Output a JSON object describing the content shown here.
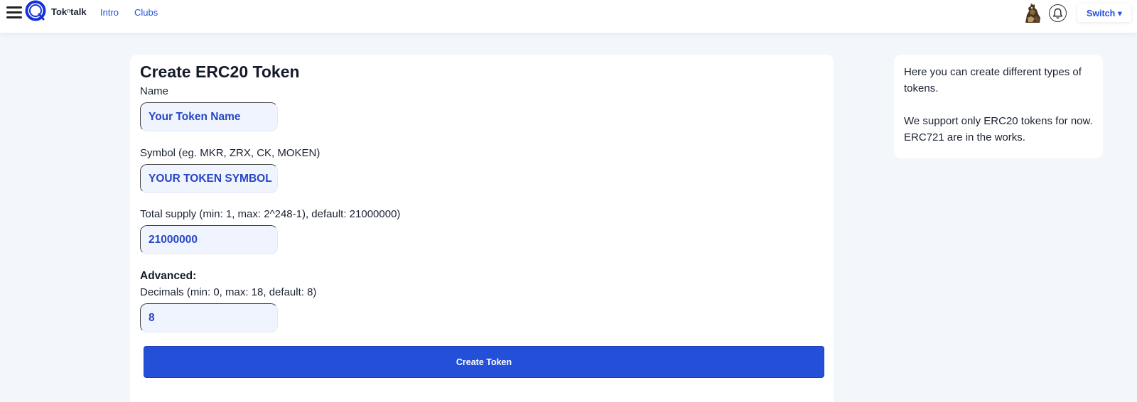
{
  "header": {
    "brand": {
      "prefix": "Tok",
      "middle": "n",
      "suffix": "talk"
    },
    "nav": [
      {
        "label": "Intro"
      },
      {
        "label": "Clubs"
      }
    ],
    "switch_label": "Switch ▾",
    "icons": {
      "menu": "hamburger-icon",
      "logo": "tokntalk-logo-icon",
      "avatar": "avatar-image",
      "notifications": "bell-icon"
    }
  },
  "form": {
    "title": "Create ERC20 Token",
    "name": {
      "label": "Name",
      "placeholder": "Your Token Name"
    },
    "symbol": {
      "label": "Symbol (eg. MKR, ZRX, CK, MOKEN)",
      "placeholder": "YOUR TOKEN SYMBOL"
    },
    "supply": {
      "label": "Total supply (min: 1, max: 2^248-1), default: 21000000)",
      "value": "21000000"
    },
    "advanced_label": "Advanced:",
    "decimals": {
      "label": "Decimals (min: 0, max: 18, default: 8)",
      "value": "8"
    },
    "submit_label": "Create Token"
  },
  "info": {
    "paragraphs": [
      "Here you can create different types of tokens.",
      "We support only ERC20 tokens for now. ERC721 are in the works."
    ]
  },
  "colors": {
    "accent": "#2450d9",
    "page_background": "#f3f6fb",
    "input_background": "#f0f4fe",
    "input_text": "#2646c4"
  }
}
